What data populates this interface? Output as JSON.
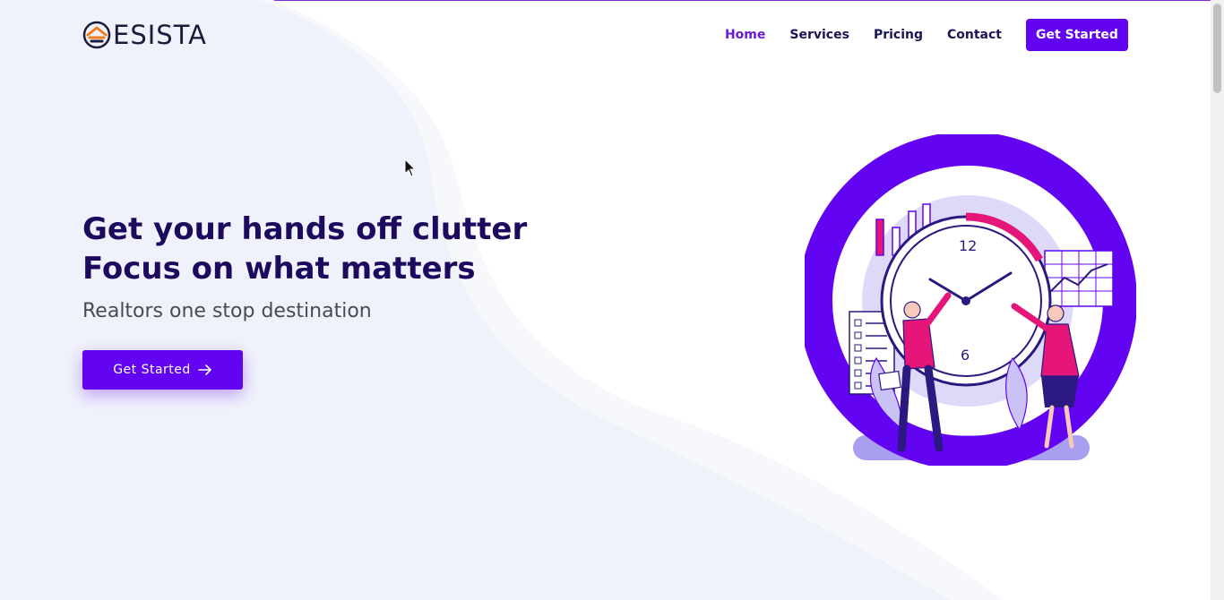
{
  "header": {
    "logo_text": "ESISTA",
    "nav": [
      {
        "label": "Home",
        "active": true
      },
      {
        "label": "Services",
        "active": false
      },
      {
        "label": "Pricing",
        "active": false
      },
      {
        "label": "Contact",
        "active": false
      }
    ],
    "cta_label": "Get Started"
  },
  "hero": {
    "title_line1": "Get your hands off clutter",
    "title_line2": "Focus on what matters",
    "subtitle": "Realtors one stop destination",
    "cta_label": "Get Started",
    "cta_icon": "arrow-right-icon"
  },
  "illustration": {
    "clock_numbers": [
      "12",
      "6"
    ],
    "icon": "clock-team-illustration"
  },
  "colors": {
    "brand": "#6203f2",
    "heading": "#1d0a5e",
    "nav_text": "#1a1656",
    "nav_active": "#6a1bd6",
    "accent_pink": "#e5157a",
    "background_wave": "#f0f2fb"
  }
}
